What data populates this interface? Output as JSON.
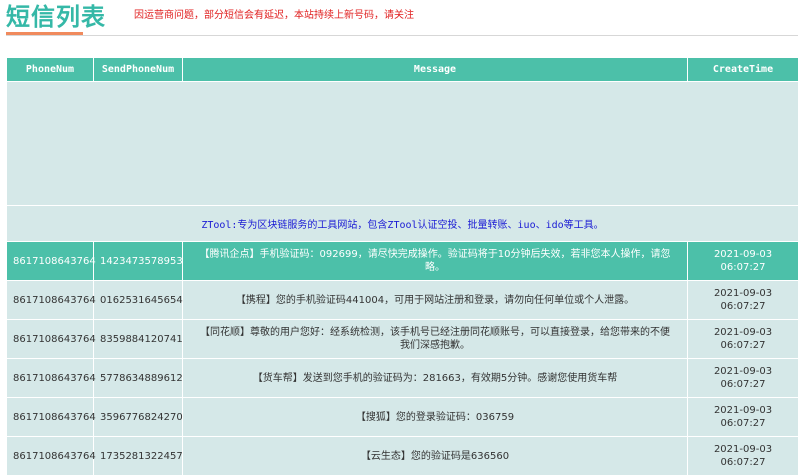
{
  "header": {
    "title": "短信列表",
    "notice": "因运营商问题，部分短信会有延迟，本站持续上新号码，请关注"
  },
  "table": {
    "columns": [
      "PhoneNum",
      "SendPhoneNum",
      "Message",
      "CreateTime"
    ],
    "promo": "ZTool:专为区块链服务的工具网站，包含ZTool认证空投、批量转账、iuo、ido等工具。",
    "rows": [
      {
        "phone": "8617108643764",
        "sender": "1423473578953",
        "message": "【腾讯企点】手机验证码：092699，请尽快完成操作。验证码将于10分钟后失效，若非您本人操作，请忽略。",
        "date": "2021-09-03",
        "time": "06:07:27"
      },
      {
        "phone": "8617108643764",
        "sender": "0162531645654",
        "message": "【携程】您的手机验证码441004，可用于网站注册和登录，请勿向任何单位或个人泄露。",
        "date": "2021-09-03",
        "time": "06:07:27"
      },
      {
        "phone": "8617108643764",
        "sender": "8359884120741",
        "message": "【同花顺】尊敬的用户您好：经系统检测，该手机号已经注册同花顺账号，可以直接登录，给您带来的不便我们深感抱歉。",
        "date": "2021-09-03",
        "time": "06:07:27"
      },
      {
        "phone": "8617108643764",
        "sender": "5778634889612",
        "message": "【货车帮】发送到您手机的验证码为：281663，有效期5分钟。感谢您使用货车帮",
        "date": "2021-09-03",
        "time": "06:07:27"
      },
      {
        "phone": "8617108643764",
        "sender": "3596776824270",
        "message": "【搜狐】您的登录验证码：036759",
        "date": "2021-09-03",
        "time": "06:07:27"
      },
      {
        "phone": "8617108643764",
        "sender": "1735281322457",
        "message": "【云生态】您的验证码是636560",
        "date": "2021-09-03",
        "time": "06:07:27"
      }
    ]
  },
  "colors": {
    "accent": "#4cc0a9",
    "title": "#35b8a7",
    "underline": "#f08a5d",
    "row_bg": "#d5e8e8",
    "notice": "#e02020",
    "promo_link": "#1a1ad4"
  }
}
